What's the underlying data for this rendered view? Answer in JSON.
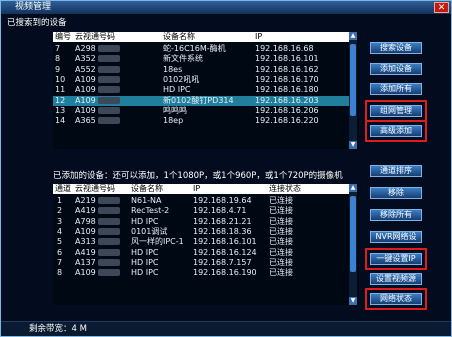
{
  "window": {
    "title": "视频管理",
    "close_glyph": "✕"
  },
  "searched": {
    "section_title": "已搜索到的设备",
    "columns": [
      "编号",
      "云视通号码",
      "设备名称",
      "IP"
    ],
    "rows": [
      {
        "num": "7",
        "code": "A298",
        "name": "蛇-16C16M-酶机",
        "ip": "192.168.16.68"
      },
      {
        "num": "8",
        "code": "A352",
        "name": "新文件系统",
        "ip": "192.168.16.101"
      },
      {
        "num": "9",
        "code": "A552",
        "name": "18es",
        "ip": "192.168.16.162"
      },
      {
        "num": "10",
        "code": "A109",
        "name": "0102吼吼",
        "ip": "192.168.16.170"
      },
      {
        "num": "11",
        "code": "A109",
        "name": "HD IPC",
        "ip": "192.168.16.180"
      },
      {
        "num": "12",
        "code": "A109",
        "name": "新0102酸钉PD314",
        "ip": "192.168.16.203",
        "selected": true
      },
      {
        "num": "13",
        "code": "A109",
        "name": "鸣鸣鸣",
        "ip": "192.168.16.206"
      },
      {
        "num": "14",
        "code": "A365",
        "name": "18ep",
        "ip": "192.168.16.220"
      }
    ]
  },
  "added": {
    "section_title": "已添加的设备：还可以添加，1个1080P，或1个960P，或1个720P的摄像机",
    "columns": [
      "通道",
      "云视通号码",
      "设备名称",
      "IP",
      "连接状态"
    ],
    "rows": [
      {
        "num": "1",
        "code": "A219",
        "name": "N61-NA",
        "ip": "192.168.19.64",
        "status": "已连接"
      },
      {
        "num": "2",
        "code": "A419",
        "name": "RecTest-2",
        "ip": "192.168.4.71",
        "status": "已连接"
      },
      {
        "num": "3",
        "code": "A798",
        "name": "HD IPC",
        "ip": "192.168.21.21",
        "status": "已连接"
      },
      {
        "num": "4",
        "code": "A109",
        "name": "0101调试",
        "ip": "192.168.18.36",
        "status": "已连接"
      },
      {
        "num": "5",
        "code": "A313",
        "name": "风一样的IPC-1",
        "ip": "192.168.16.101",
        "status": "已连接"
      },
      {
        "num": "6",
        "code": "A419",
        "name": "HD IPC",
        "ip": "192.168.16.124",
        "status": "已连接"
      },
      {
        "num": "7",
        "code": "A137",
        "name": "HD IPC",
        "ip": "192.168.7.157",
        "status": "已连接"
      },
      {
        "num": "8",
        "code": "A109",
        "name": "HD IPC",
        "ip": "192.168.16.190",
        "status": "已连接"
      }
    ]
  },
  "buttons": {
    "search": "搜索设备",
    "add": "添加设备",
    "add_all": "添加所有",
    "network": "组网管理",
    "advanced_add": "高级添加",
    "channel_sort": "通道排序",
    "remove": "移除",
    "remove_all": "移除所有",
    "nvr_network": "NVR网络设",
    "one_key_ip": "一键设置IP",
    "set_video_source": "设置视频源",
    "network_status": "网络状态"
  },
  "footer": {
    "remaining_bandwidth": "剩余带宽：4 M"
  },
  "colors": {
    "highlight_outline": "#e01d1d",
    "selected_row": "#1f7f9c"
  }
}
